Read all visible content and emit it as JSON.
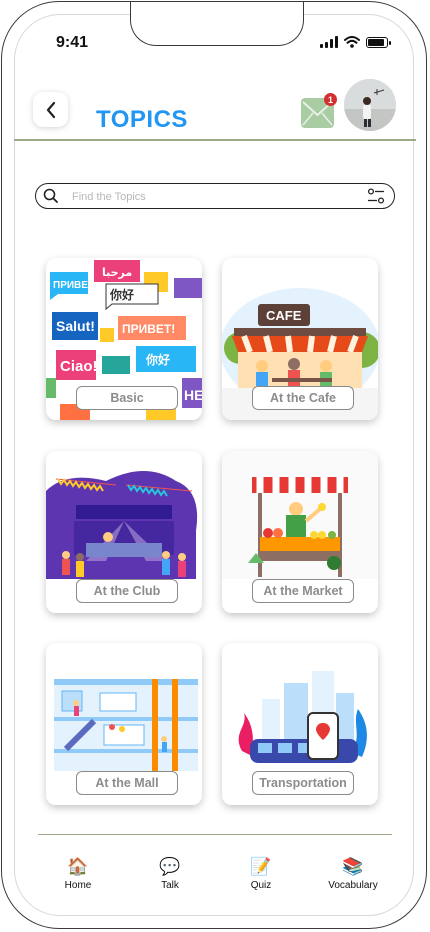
{
  "status": {
    "time": "9:41"
  },
  "header": {
    "title": "TOPICS",
    "mail_badge": "1",
    "title_color": "#2196F3"
  },
  "search": {
    "placeholder": "Find the Topics",
    "value": ""
  },
  "topics": [
    {
      "label": "Basic"
    },
    {
      "label": "At the Cafe"
    },
    {
      "label": "At the Club"
    },
    {
      "label": "At the Market"
    },
    {
      "label": "At the Mall"
    },
    {
      "label": "Transportation"
    }
  ],
  "art_text": {
    "basic": [
      "Salut!",
      "Ciao!",
      "你好",
      "ПРИВЕТ!",
      "مرحبا",
      "HE"
    ],
    "cafe": "CAFE"
  },
  "nav": [
    {
      "label": "Home",
      "icon": "house-icon"
    },
    {
      "label": "Talk",
      "icon": "speech-bubble-icon"
    },
    {
      "label": "Quiz",
      "icon": "notepad-icon"
    },
    {
      "label": "Vocabulary",
      "icon": "books-icon"
    }
  ]
}
